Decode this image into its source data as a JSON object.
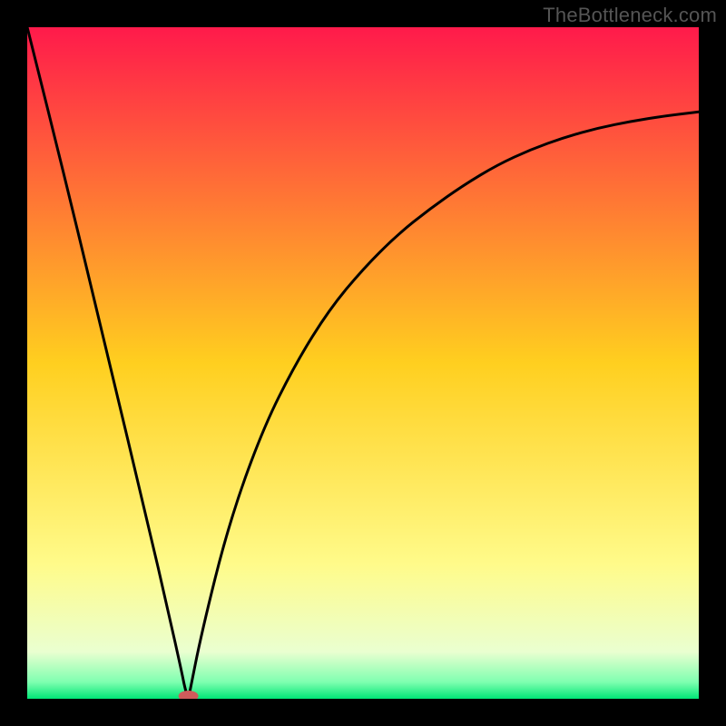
{
  "watermark": "TheBottleneck.com",
  "chart_data": {
    "type": "line",
    "title": "",
    "xlabel": "",
    "ylabel": "",
    "xlim": [
      0,
      1
    ],
    "ylim": [
      0,
      1
    ],
    "grid": false,
    "legend": false,
    "background_gradient": {
      "stops": [
        {
          "offset": 0.0,
          "color": "#ff1a4b"
        },
        {
          "offset": 0.5,
          "color": "#ffcf1f"
        },
        {
          "offset": 0.8,
          "color": "#fffb8a"
        },
        {
          "offset": 0.93,
          "color": "#eaffd0"
        },
        {
          "offset": 0.975,
          "color": "#7fffb0"
        },
        {
          "offset": 1.0,
          "color": "#00e676"
        }
      ]
    },
    "series": [
      {
        "name": "left-branch",
        "comment": "Steep near-linear descent from top-left into the minimum near x≈0.24",
        "x": [
          0.0,
          0.06,
          0.12,
          0.18,
          0.21,
          0.23,
          0.235,
          0.24
        ],
        "values": [
          1.0,
          0.76,
          0.51,
          0.26,
          0.13,
          0.04,
          0.015,
          0.0
        ]
      },
      {
        "name": "right-branch",
        "comment": "Rises from the same minimum, concave, saturating toward ~0.87 at x=1",
        "x": [
          0.24,
          0.26,
          0.3,
          0.35,
          0.4,
          0.45,
          0.5,
          0.55,
          0.6,
          0.65,
          0.7,
          0.75,
          0.8,
          0.85,
          0.9,
          0.95,
          1.0
        ],
        "values": [
          0.0,
          0.1,
          0.26,
          0.4,
          0.5,
          0.58,
          0.64,
          0.69,
          0.73,
          0.765,
          0.795,
          0.818,
          0.836,
          0.85,
          0.86,
          0.868,
          0.874
        ]
      }
    ],
    "marker": {
      "name": "minimum-marker",
      "x": 0.24,
      "y": 0.0,
      "color": "#cf5b5b",
      "rx": 11,
      "ry": 6
    }
  }
}
